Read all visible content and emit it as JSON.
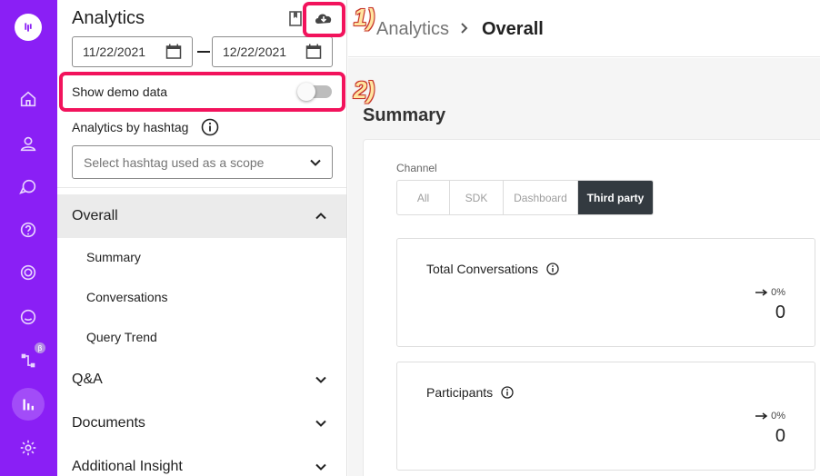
{
  "sidebar_panel": {
    "title": "Analytics",
    "date_from": "11/22/2021",
    "date_to": "12/22/2021",
    "demo_toggle_label": "Show demo data",
    "demo_toggle_on": false,
    "hashtag_label": "Analytics by hashtag",
    "hashtag_placeholder": "Select hashtag used as a scope",
    "sections": [
      {
        "label": "Overall",
        "expanded": true,
        "items": [
          "Summary",
          "Conversations",
          "Query Trend"
        ]
      },
      {
        "label": "Q&A",
        "expanded": false
      },
      {
        "label": "Documents",
        "expanded": false
      },
      {
        "label": "Additional Insight",
        "expanded": false
      }
    ]
  },
  "rail": {
    "beta_badge": "β",
    "icons": [
      "logo-icon",
      "home-icon",
      "user-icon",
      "chat-icon",
      "help-icon",
      "target-icon",
      "message-icon",
      "workflow-icon",
      "analytics-icon",
      "gear-icon"
    ]
  },
  "breadcrumb": {
    "parent": "Analytics",
    "current": "Overall"
  },
  "main": {
    "section_title": "Summary",
    "channel_label": "Channel",
    "channels": [
      "All",
      "SDK",
      "Dashboard",
      "Third party"
    ],
    "selected_channel": "Third party",
    "stats": [
      {
        "label": "Total Conversations",
        "delta": "0%",
        "value": "0"
      },
      {
        "label": "Participants",
        "delta": "0%",
        "value": "0"
      }
    ]
  },
  "annotations": {
    "one": "1)",
    "two": "2)"
  },
  "colors": {
    "rail": "#8a1ff5",
    "highlight": "#f2135c",
    "selected_channel": "#333a40"
  }
}
